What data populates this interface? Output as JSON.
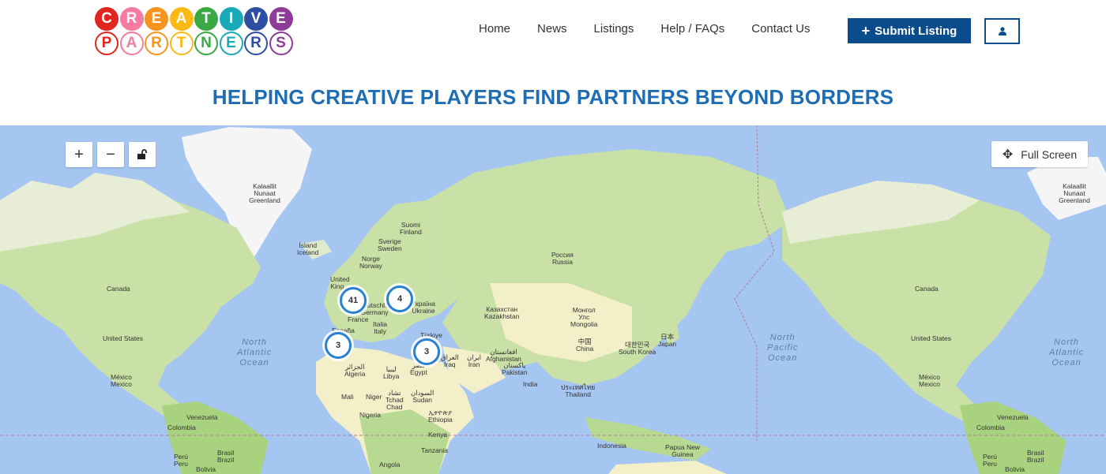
{
  "logo": {
    "row1": [
      "C",
      "R",
      "E",
      "A",
      "T",
      "I",
      "V",
      "E"
    ],
    "row2": [
      "P",
      "A",
      "R",
      "T",
      "N",
      "E",
      "R",
      "S"
    ],
    "colors": [
      "#e0261f",
      "#f57ba1",
      "#f7941d",
      "#fcb813",
      "#3aa843",
      "#1aa9b9",
      "#2d4ea3",
      "#8d3c98"
    ]
  },
  "nav": {
    "home": "Home",
    "news": "News",
    "listings": "Listings",
    "help": "Help / FAQs",
    "contact": "Contact Us"
  },
  "submit_button": {
    "icon": "plus-icon",
    "label": "Submit Listing"
  },
  "user_button": {
    "icon": "user-icon"
  },
  "tagline": "HELPING CREATIVE PLAYERS FIND PARTNERS BEYOND BORDERS",
  "map": {
    "controls": {
      "zoom_in": "+",
      "zoom_out": "−",
      "lock_icon": "unlock-icon"
    },
    "fullscreen": {
      "icon": "move-icon",
      "label": "Full Screen"
    },
    "clusters": [
      "41",
      "4",
      "3",
      "3"
    ],
    "labels": {
      "greenland_l": "Kalaallit\nNunaat\nGreenland",
      "greenland_r": "Kalaallit\nNunaat\nGreenland",
      "iceland": "Ísland\nIceland",
      "finland": "Suomi\nFinland",
      "sweden": "Sverige\nSweden",
      "norway": "Norge\nNorway",
      "uk": "United\nKing...",
      "germany": "Deutschl...\nGermany",
      "france": "France",
      "ukraine": "Україна\nUkraine",
      "spain": "España",
      "italy": "Italia\nItaly",
      "turkey": "Türkiye",
      "russia": "Россия\nRussia",
      "kazakhstan": "Казахстан\nKazakhstan",
      "mongolia": "Монгол\nУлс\nMongolia",
      "china": "中国\nChina",
      "japan": "日本\nJapan",
      "korea": "대한민국\nSouth Korea",
      "iran": "ایران\nIran",
      "iraq": "العراق\nIraq",
      "afghanistan": "افغانستان\nAfghanistan",
      "pakistan": "پاکستان\nPakistan",
      "india": "India",
      "thailand": "ประเทศไทย\nThailand",
      "indonesia": "Indonesia",
      "png": "Papua New\nGuinea",
      "algeria": "الجزائر\nAlgeria",
      "libya": "ليبيا\nLibya",
      "egypt": "مصر\nEgypt",
      "mali": "Mali",
      "niger": "Niger",
      "chad": "تشاد\nTchad\nChad",
      "sudan": "السودان\nSudan",
      "nigeria": "Nigeria",
      "ethiopia": "ኢትዮጵያ\nEthiopia",
      "kenya": "Kenya",
      "tanzania": "Tanzania",
      "angola": "Angola",
      "canada_l": "Canada",
      "canada_r": "Canada",
      "us_l": "United States",
      "us_r": "United States",
      "mexico_l": "México\nMexico",
      "mexico_r": "México\nMexico",
      "venezuela_l": "Venezuela",
      "venezuela_r": "Venezuela",
      "colombia_l": "Colombia",
      "colombia_r": "Colombia",
      "peru_l": "Perú\nPeru",
      "peru_r": "Perú\nPeru",
      "brazil_l": "Brasil\nBrazil",
      "brazil_r": "Brasil\nBrazil",
      "bolivia_l": "Bolivia",
      "bolivia_r": "Bolivia"
    },
    "oceans": {
      "n_atlantic_l": "North\nAtlantic\nOcean",
      "n_pacific": "North\nPacific\nOcean",
      "n_atlantic_r": "North\nAtlantic\nOcean"
    }
  }
}
